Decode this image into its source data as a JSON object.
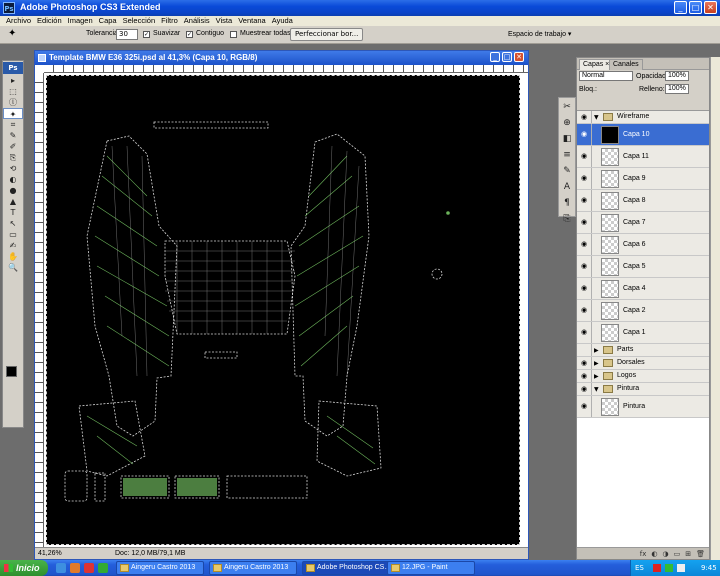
{
  "window": {
    "app_logo": "Ps",
    "title": "Adobe Photoshop CS3 Extended",
    "btn_min": "_",
    "btn_max": "□",
    "btn_close": "✕"
  },
  "menu": [
    "Archivo",
    "Edición",
    "Imagen",
    "Capa",
    "Selección",
    "Filtro",
    "Análisis",
    "Vista",
    "Ventana",
    "Ayuda"
  ],
  "options": {
    "tool_glyph": "✦",
    "tolerance_label": "Tolerancia:",
    "tolerance_value": "30",
    "smooth_label": "Suavizar",
    "smooth_checked": "✓",
    "contiguous_label": "Contiguo",
    "contiguous_checked": "✓",
    "sample_all_label": "Muestrear todas las capas",
    "refine_label": "Perfeccionar bor...",
    "workspace_label": "Espacio de trabajo ▾"
  },
  "toolbox": {
    "logo": "Ps",
    "tools": [
      "▸",
      "⬚",
      "ⓛ",
      "✦",
      "⌗",
      "✎",
      "✐",
      "⎘",
      "⟲",
      "◐",
      "●",
      "▲",
      "T",
      "↖",
      "▭",
      "✍",
      "✋",
      "🔍"
    ]
  },
  "document": {
    "title": "Template BMW E36 325i.psd al 41,3% (Capa 10, RGB/8)",
    "btn_min": "_",
    "btn_max": "□",
    "btn_close": "✕",
    "zoom": "41,26%",
    "doc_info": "Doc: 12,0 MB/79,1 MB"
  },
  "strip_icons": [
    "✂",
    "⊕",
    "◧",
    "≡",
    "✎",
    "A",
    "¶",
    "⎘"
  ],
  "layers_panel": {
    "tabs": [
      "Capas ×",
      "Canales"
    ],
    "blend_mode": "Normal",
    "opacity_label": "Opacidad:",
    "opacity_value": "100%",
    "lock_label": "Bloq.:",
    "fill_label": "Relleno:",
    "fill_value": "100%",
    "rows": [
      {
        "type": "group",
        "name": "Wireframe",
        "open": true,
        "visible": true
      },
      {
        "type": "layer",
        "name": "Capa 10",
        "selected": true,
        "visible": true
      },
      {
        "type": "layer",
        "name": "Capa 11",
        "visible": true
      },
      {
        "type": "layer",
        "name": "Capa 9",
        "visible": true
      },
      {
        "type": "layer",
        "name": "Capa 8",
        "visible": true
      },
      {
        "type": "layer",
        "name": "Capa 7",
        "visible": true
      },
      {
        "type": "layer",
        "name": "Capa 6",
        "visible": true
      },
      {
        "type": "layer",
        "name": "Capa 5",
        "visible": true
      },
      {
        "type": "layer",
        "name": "Capa 4",
        "visible": true
      },
      {
        "type": "layer",
        "name": "Capa 2",
        "visible": true
      },
      {
        "type": "layer",
        "name": "Capa 1",
        "visible": true
      },
      {
        "type": "group",
        "name": "Parts",
        "open": false,
        "visible": false
      },
      {
        "type": "group",
        "name": "Dorsales",
        "open": false,
        "visible": true
      },
      {
        "type": "group",
        "name": "Logos",
        "open": false,
        "visible": true
      },
      {
        "type": "group",
        "name": "Pintura",
        "open": true,
        "visible": true
      },
      {
        "type": "layer",
        "name": "Pintura",
        "visible": true
      }
    ],
    "footer_icons": [
      "fx",
      "◐",
      "◑",
      "▭",
      "⊞",
      "🗑"
    ]
  },
  "taskbar": {
    "start_label": "Inicio",
    "tasks": [
      {
        "label": "Aingeru Castro 2013",
        "active": false
      },
      {
        "label": "Aingeru Castro 2013",
        "active": false
      },
      {
        "label": "Adobe Photoshop CS...",
        "active": true
      },
      {
        "label": "12.JPG - Paint",
        "active": false
      }
    ],
    "lang": "ES",
    "clock": "9:45"
  },
  "colors": {
    "title_blue": "#0a4ad8",
    "wire_green": "#7fd36b",
    "selected_layer": "#3a6dd2"
  }
}
